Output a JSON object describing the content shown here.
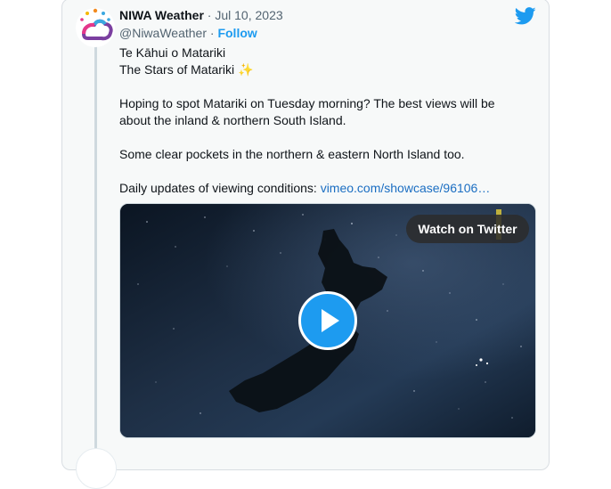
{
  "tweet": {
    "author_name": "NIWA Weather",
    "date_separator": " · ",
    "date": "Jul 10, 2023",
    "handle": "@NiwaWeather",
    "handle_separator": " · ",
    "follow_label": "Follow",
    "lines": [
      "Te Kāhui o Matariki",
      "The Stars of Matariki"
    ],
    "sparkle": "✨",
    "paragraph_1": "Hoping to spot Matariki on Tuesday morning? The best views will be about the inland & northern South Island.",
    "paragraph_2": "Some clear pockets in the northern & eastern North Island too.",
    "paragraph_3_prefix": "Daily updates of viewing conditions: ",
    "link_text": "vimeo.com/showcase/96106…"
  },
  "media": {
    "watch_label": "Watch on Twitter",
    "play_icon": "play-icon"
  },
  "icons": {
    "brand": "twitter-bird-icon",
    "avatar": "niwa-logo-icon"
  },
  "colors": {
    "accent": "#1d9bf0",
    "link": "#1b6ec2",
    "text": "#0f1419",
    "muted": "#536471",
    "card_bg": "#f7f9f9"
  }
}
